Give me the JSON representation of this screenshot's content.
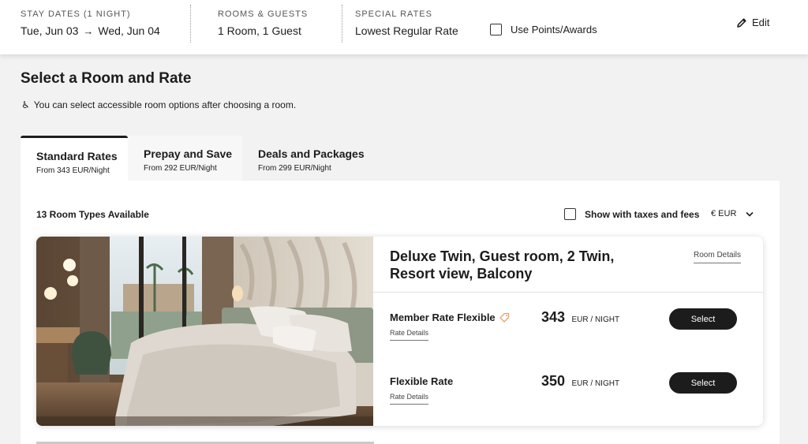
{
  "header": {
    "stay_label": "STAY DATES (1 NIGHT)",
    "check_in": "Tue, Jun 03",
    "check_out": "Wed, Jun 04",
    "rooms_label": "ROOMS & GUESTS",
    "rooms_value": "1 Room, 1 Guest",
    "rates_label": "SPECIAL RATES",
    "rates_value": "Lowest Regular Rate",
    "points_label": "Use Points/Awards",
    "edit_label": "Edit"
  },
  "page": {
    "title": "Select a Room and Rate",
    "accessible_note": "You can select accessible room options after choosing a room."
  },
  "tabs": [
    {
      "title": "Standard Rates",
      "sub": "From 343 EUR/Night"
    },
    {
      "title": "Prepay and Save",
      "sub": "From 292 EUR/Night"
    },
    {
      "title": "Deals and Packages",
      "sub": "From 299 EUR/Night"
    }
  ],
  "panel": {
    "room_types_count": "13 Room Types Available",
    "taxes_label": "Show with taxes and fees",
    "currency": "€ EUR"
  },
  "room": {
    "name": "Deluxe Twin, Guest room, 2 Twin, Resort view, Balcony",
    "details_link": "Room Details",
    "rates": [
      {
        "name": "Member Rate Flexible",
        "details": "Rate Details",
        "price": "343",
        "unit": "EUR / NIGHT",
        "button": "Select"
      },
      {
        "name": "Flexible Rate",
        "details": "Rate Details",
        "price": "350",
        "unit": "EUR / NIGHT",
        "button": "Select"
      }
    ]
  },
  "icons": {
    "arrow": "right-arrow-icon",
    "edit": "pencil-icon",
    "accessible": "wheelchair-icon",
    "tag": "tag-icon",
    "chevron": "chevron-down-icon"
  },
  "colors": {
    "button_bg": "#1c1c1c",
    "tag_accent": "#e8a06a",
    "page_bg": "#f2f2f2"
  }
}
